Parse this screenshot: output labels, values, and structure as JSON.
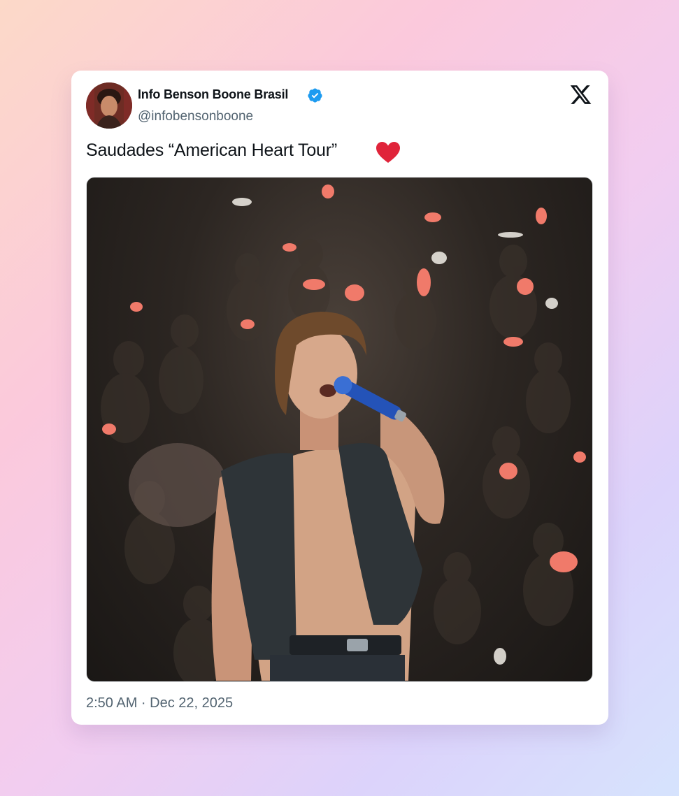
{
  "tweet": {
    "display_name": "Info Benson Boone Brasil",
    "handle": "@infobensonboone",
    "verified_icon": "verified-badge-icon",
    "platform_icon": "x-logo-icon",
    "text": "Saudades “American Heart Tour”",
    "emoji_icon": "red-heart-emoji-icon",
    "timestamp": "2:50 AM · Dec 22, 2025",
    "image_description_icon": "concert-photo"
  },
  "colors": {
    "verified_blue": "#1d9bf0",
    "heart_red": "#e0243a",
    "text_primary": "#0f1419",
    "text_secondary": "#536471"
  }
}
